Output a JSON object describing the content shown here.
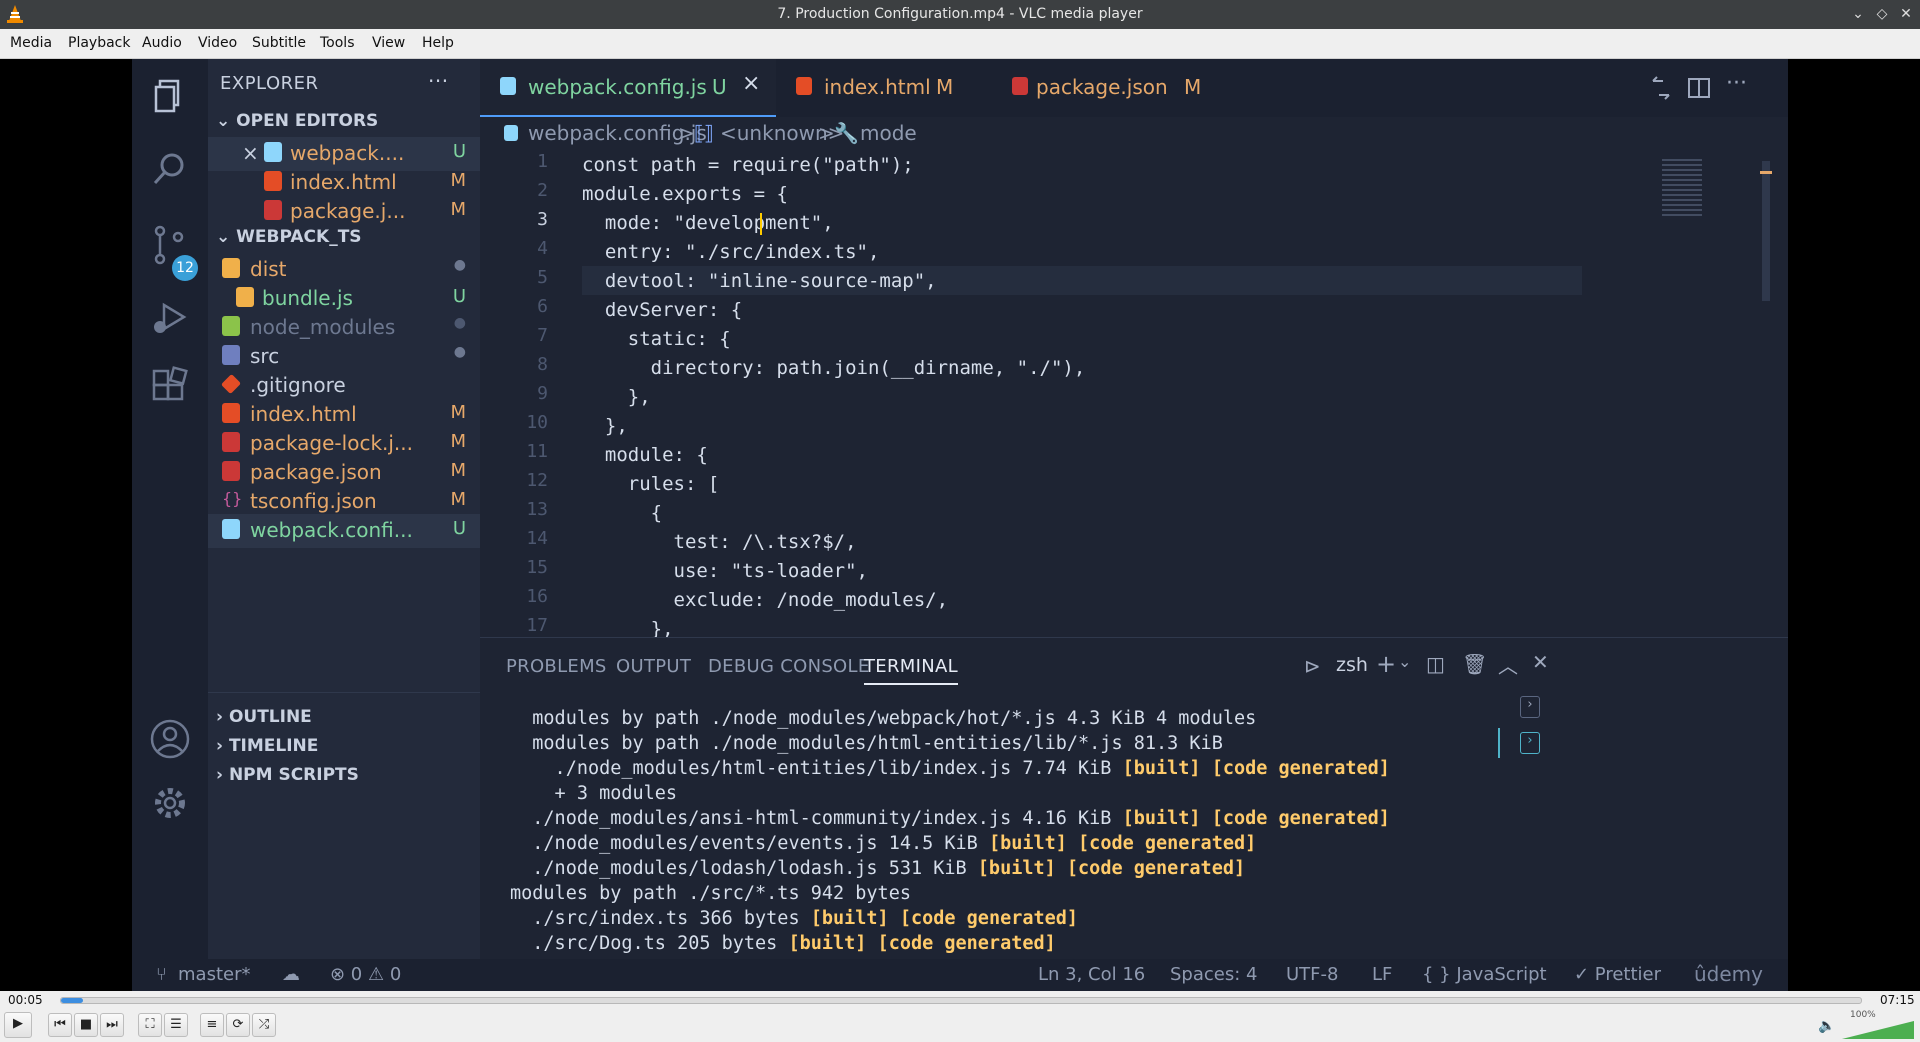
{
  "window": {
    "title": "7. Production Configuration.mp4 - VLC media player"
  },
  "menu": [
    "Media",
    "Playback",
    "Audio",
    "Video",
    "Subtitle",
    "Tools",
    "View",
    "Help"
  ],
  "vscode": {
    "activity": {
      "scm_badge": "12"
    },
    "explorer": {
      "title": "EXPLORER",
      "more": "···",
      "open_editors_label": "OPEN EDITORS",
      "open_editors": [
        {
          "name": "webpack....",
          "status": "U",
          "icon": "webpack-icon",
          "color": "#8ed6fb",
          "close": "×"
        },
        {
          "name": "index.html",
          "status": "M",
          "icon": "html-icon",
          "color": "#e44d26"
        },
        {
          "name": "package.j...",
          "status": "M",
          "icon": "npm-icon",
          "color": "#cb3837"
        }
      ],
      "project_label": "WEBPACK_TS",
      "files": [
        {
          "name": "dist",
          "status": "●",
          "icon": "folder-dist-icon",
          "color": "#f0b04a"
        },
        {
          "name": "bundle.js",
          "status": "U",
          "icon": "js-icon",
          "color": "#f0b04a"
        },
        {
          "name": "node_modules",
          "status": "●",
          "icon": "folder-node-icon",
          "color": "#8bc34a"
        },
        {
          "name": "src",
          "status": "●",
          "icon": "folder-src-icon",
          "color": "#6f7fbf"
        },
        {
          "name": ".gitignore",
          "status": "",
          "icon": "git-icon",
          "color": "#e44d26"
        },
        {
          "name": "index.html",
          "status": "M",
          "icon": "html-icon",
          "color": "#e44d26"
        },
        {
          "name": "package-lock.j...",
          "status": "M",
          "icon": "npm-lock-icon",
          "color": "#cb3837"
        },
        {
          "name": "package.json",
          "status": "M",
          "icon": "npm-icon",
          "color": "#cb3837"
        },
        {
          "name": "tsconfig.json",
          "status": "M",
          "icon": "json-icon",
          "color": "#c65b9d"
        },
        {
          "name": "webpack.confi...",
          "status": "U",
          "icon": "webpack-icon",
          "color": "#8ed6fb"
        }
      ],
      "outline": "OUTLINE",
      "timeline": "TIMELINE",
      "npm_scripts": "NPM SCRIPTS"
    },
    "tabs": [
      {
        "name": "webpack.config.js",
        "status": "U",
        "close": "×"
      },
      {
        "name": "index.html",
        "status": "M"
      },
      {
        "name": "package.json",
        "status": "M"
      }
    ],
    "breadcrumb": {
      "file": "webpack.config.js",
      "sep": ">",
      "scope": "<unknown>",
      "symbol": "mode"
    },
    "line_numbers": [
      "1",
      "2",
      "3",
      "4",
      "5",
      "6",
      "7",
      "8",
      "9",
      "10",
      "11",
      "12",
      "13",
      "14",
      "15",
      "16",
      "17"
    ],
    "code": [
      "const path = require(\"path\");",
      "module.exports = {",
      "  mode: \"development\",",
      "  entry: \"./src/index.ts\",",
      "  devtool: \"inline-source-map\",",
      "  devServer: {",
      "    static: {",
      "      directory: path.join(__dirname, \"./\"),",
      "    },",
      "  },",
      "  module: {",
      "    rules: [",
      "      {",
      "        test: /\\.tsx?$/,",
      "        use: \"ts-loader\",",
      "        exclude: /node_modules/,",
      "      },"
    ],
    "panel": {
      "tabs": [
        "PROBLEMS",
        "OUTPUT",
        "DEBUG CONSOLE",
        "TERMINAL"
      ],
      "shell": "zsh",
      "terminal": [
        {
          "text": "  modules by path ./node_modules/webpack/hot/*.js 4.3 KiB 4 modules",
          "tail": ""
        },
        {
          "text": "  modules by path ./node_modules/html-entities/lib/*.js 81.3 KiB",
          "tail": ""
        },
        {
          "text": "    ./node_modules/html-entities/lib/index.js 7.74 KiB ",
          "tail": "[built] [code generated]"
        },
        {
          "text": "    + 3 modules",
          "tail": ""
        },
        {
          "text": "  ./node_modules/ansi-html-community/index.js 4.16 KiB ",
          "tail": "[built] [code generated]"
        },
        {
          "text": "  ./node_modules/events/events.js 14.5 KiB ",
          "tail": "[built] [code generated]"
        },
        {
          "text": "  ./node_modules/lodash/lodash.js 531 KiB ",
          "tail": "[built] [code generated]"
        },
        {
          "text": "modules by path ./src/*.ts 942 bytes",
          "tail": ""
        },
        {
          "text": "  ./src/index.ts 366 bytes ",
          "tail": "[built] [code generated]"
        },
        {
          "text": "  ./src/Dog.ts 205 bytes ",
          "tail": "[built] [code generated]"
        }
      ]
    },
    "status": {
      "branch": "master*",
      "problems": "⊗ 0 ⚠ 0",
      "position": "Ln 3, Col 16",
      "spaces": "Spaces: 4",
      "encoding": "UTF-8",
      "eol": "LF",
      "language": "{ } JavaScript",
      "prettier": "✓ Prettier",
      "watermark": "ûdemy"
    }
  },
  "player": {
    "elapsed": "00:05",
    "total": "07:15",
    "progress": 0.012,
    "volume_label": "100%",
    "volume": 1.0
  }
}
